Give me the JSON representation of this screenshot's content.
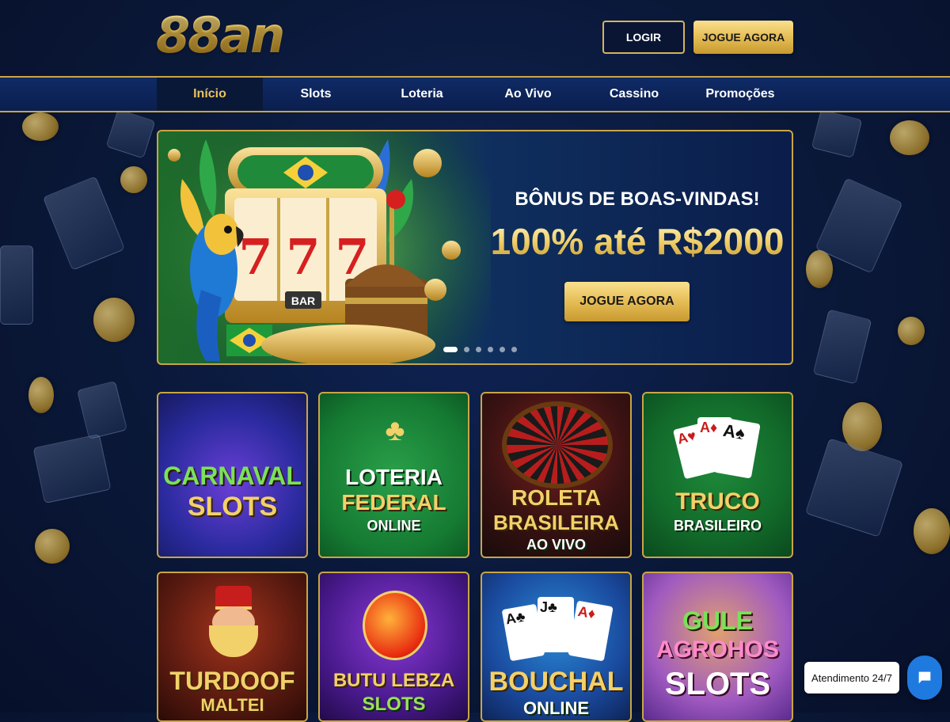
{
  "header": {
    "logo": "88an",
    "login_label": "LOGIR",
    "play_label": "JOGUE AGORA"
  },
  "nav": {
    "items": [
      {
        "label": "Início",
        "active": true
      },
      {
        "label": "Slots",
        "active": false
      },
      {
        "label": "Loteria",
        "active": false
      },
      {
        "label": "Ao Vivo",
        "active": false
      },
      {
        "label": "Cassino",
        "active": false
      },
      {
        "label": "Promoções",
        "active": false
      }
    ]
  },
  "banner": {
    "title": "BÔNUS DE BOAS-VINDAS!",
    "offer": "100% até R$2000",
    "cta": "JOGUE AGORA",
    "slot_reels": [
      "7",
      "7",
      "7"
    ],
    "slot_label": "BAR",
    "slide_count": 6,
    "active_slide": 1
  },
  "games": [
    {
      "line1": "CARNAVAL",
      "line2": "SLOTS",
      "line3": ""
    },
    {
      "line1": "LOTERIA",
      "line2": "FEDERAL",
      "line3": "ONLINE"
    },
    {
      "line1": "ROLETA",
      "line2": "BRASILEIRA",
      "line3": "AO VIVO"
    },
    {
      "line1": "TRUCO",
      "line2": "BRASILEIRO",
      "line3": ""
    },
    {
      "line1": "TURDOOF",
      "line2": "MALTEI",
      "line3": ""
    },
    {
      "line1": "BUTU LEBZA",
      "line2": "SLOTS",
      "line3": ""
    },
    {
      "line1": "BOUCHAL",
      "line2": "ONLINE",
      "line3": ""
    },
    {
      "line1": "GULE",
      "line2": "AGROHOS",
      "line3": "SLOTS"
    }
  ],
  "chat": {
    "label": "Atendimento 24/7"
  },
  "colors": {
    "gold": "#c9a545",
    "navy": "#0a1838",
    "chat_blue": "#1f7ae0"
  }
}
